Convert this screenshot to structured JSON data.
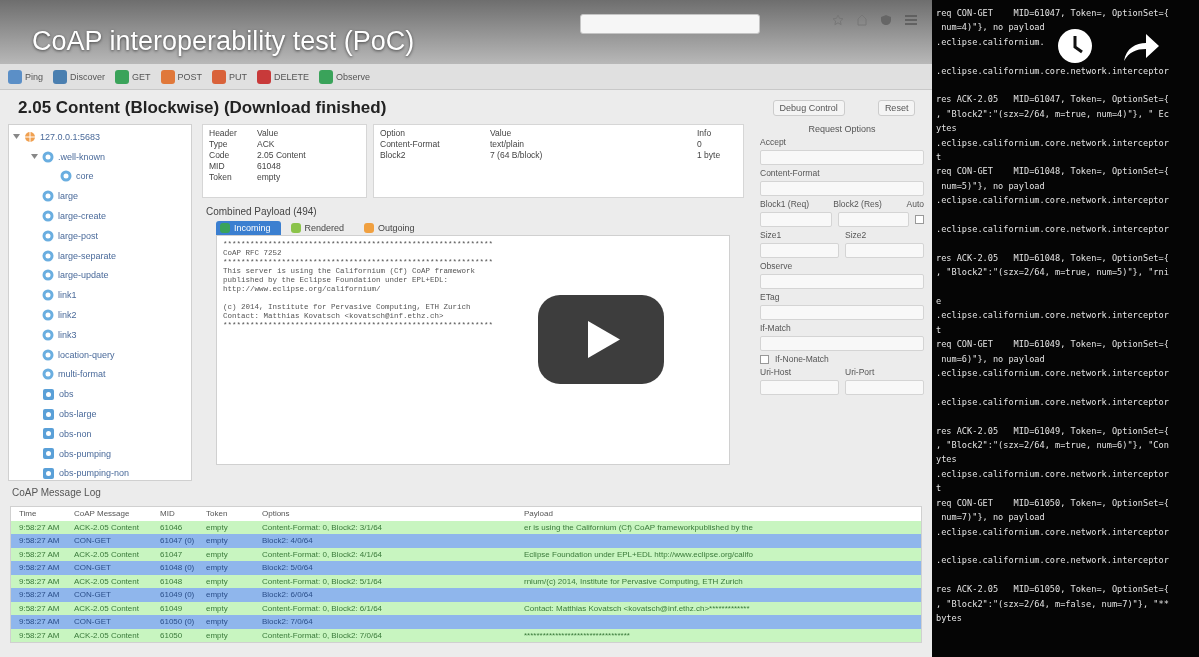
{
  "video": {
    "title": "CoAP interoperability test (PoC)"
  },
  "toolbar": {
    "buttons": [
      {
        "label": "Ping",
        "color": "#5b8fc7"
      },
      {
        "label": "Discover",
        "color": "#4a7fb0"
      },
      {
        "label": "GET",
        "color": "#3aa35a"
      },
      {
        "label": "POST",
        "color": "#e0783a"
      },
      {
        "label": "PUT",
        "color": "#d9623a"
      },
      {
        "label": "DELETE",
        "color": "#c83a3a"
      },
      {
        "label": "Observe",
        "color": "#3aa35a"
      }
    ]
  },
  "heading": "2.05 Content (Blockwise) (Download finished)",
  "tree": [
    {
      "label": "127.0.0.1:5683",
      "kind": "host",
      "expanded": true,
      "children": [
        {
          "label": ".well-known",
          "kind": "resource",
          "expanded": true,
          "children": [
            {
              "label": "core",
              "kind": "resource"
            }
          ]
        },
        {
          "label": "large",
          "kind": "resource"
        },
        {
          "label": "large-create",
          "kind": "resource"
        },
        {
          "label": "large-post",
          "kind": "resource"
        },
        {
          "label": "large-separate",
          "kind": "resource"
        },
        {
          "label": "large-update",
          "kind": "resource"
        },
        {
          "label": "link1",
          "kind": "resource"
        },
        {
          "label": "link2",
          "kind": "resource"
        },
        {
          "label": "link3",
          "kind": "resource"
        },
        {
          "label": "location-query",
          "kind": "resource"
        },
        {
          "label": "multi-format",
          "kind": "resource"
        },
        {
          "label": "obs",
          "kind": "observable"
        },
        {
          "label": "obs-large",
          "kind": "observable"
        },
        {
          "label": "obs-non",
          "kind": "observable"
        },
        {
          "label": "obs-pumping",
          "kind": "observable"
        },
        {
          "label": "obs-pumping-non",
          "kind": "observable"
        }
      ]
    }
  ],
  "header_table": {
    "columns": [
      "Header",
      "Value"
    ],
    "rows": [
      [
        "Type",
        "ACK"
      ],
      [
        "Code",
        "2.05 Content"
      ],
      [
        "MID",
        "61048"
      ],
      [
        "Token",
        "empty"
      ]
    ]
  },
  "options_table": {
    "columns": [
      "Option",
      "Value",
      "Info"
    ],
    "rows": [
      [
        "Content-Format",
        "text/plain",
        "0"
      ],
      [
        "Block2",
        "7 (64 B/block)",
        "1 byte"
      ]
    ]
  },
  "payload": {
    "title": "Combined Payload (494)",
    "tabs": [
      {
        "label": "Incoming",
        "selected": true
      },
      {
        "label": "Rendered",
        "selected": false
      },
      {
        "label": "Outgoing",
        "selected": false
      }
    ],
    "blocks": [
      [
        "************************************************************",
        "CoAP RFC 7252",
        "************************************************************",
        "This server is using the Californium (Cf) CoAP framework",
        "published by the Eclipse Foundation under EPL+EDL:",
        "http://www.eclipse.org/californium/"
      ],
      [
        "(c) 2014, Institute for Pervasive Computing, ETH Zurich",
        "Contact: Matthias Kovatsch <kovatsch@inf.ethz.ch>",
        "************************************************************"
      ]
    ]
  },
  "control_panel": {
    "buttons": [
      "Debug Control",
      "Reset"
    ],
    "items": [
      {
        "kind": "title",
        "label": "Request Options"
      },
      {
        "kind": "field",
        "labels": [
          "Accept"
        ]
      },
      {
        "kind": "field",
        "labels": [
          "Content-Format"
        ]
      },
      {
        "kind": "pair",
        "labels": [
          "Block1 (Req)",
          "Block2 (Res)",
          "Auto"
        ],
        "checked": false
      },
      {
        "kind": "pair",
        "labels": [
          "Size1",
          "Size2"
        ]
      },
      {
        "kind": "field",
        "labels": [
          "Observe"
        ]
      },
      {
        "kind": "field",
        "labels": [
          "ETag"
        ]
      },
      {
        "kind": "field",
        "labels": [
          "If-Match"
        ]
      },
      {
        "kind": "check",
        "labels": [
          "If-None-Match"
        ],
        "checked": false
      },
      {
        "kind": "pair",
        "labels": [
          "Uri-Host",
          "Uri-Port"
        ]
      }
    ]
  },
  "log": {
    "title": "CoAP Message Log",
    "columns": [
      "Time",
      "CoAP Message",
      "MID",
      "Token",
      "Options",
      "Payload"
    ],
    "rows": [
      {
        "kind": "ack",
        "cells": [
          "9:58:27 AM",
          "ACK-2.05 Content",
          "61046",
          "empty",
          "Content-Format: 0, Block2: 3/1/64",
          "er is using the Californium (Cf) CoAP frameworkpublished by the"
        ]
      },
      {
        "kind": "con",
        "cells": [
          "9:58:27 AM",
          "CON-GET",
          "61047 (0)",
          "empty",
          "Block2: 4/0/64"
        ]
      },
      {
        "kind": "ack",
        "cells": [
          "9:58:27 AM",
          "ACK-2.05 Content",
          "61047",
          "empty",
          "Content-Format: 0, Block2: 4/1/64",
          " Eclipse Foundation under EPL+EDL http://www.eclipse.org/califo"
        ]
      },
      {
        "kind": "con",
        "cells": [
          "9:58:27 AM",
          "CON-GET",
          "61048 (0)",
          "empty",
          "Block2: 5/0/64"
        ]
      },
      {
        "kind": "ack",
        "cells": [
          "9:58:27 AM",
          "ACK-2.05 Content",
          "61048",
          "empty",
          "Content-Format: 0, Block2: 5/1/64",
          "rnium/(c) 2014, Institute for Pervasive Computing, ETH Zurich"
        ]
      },
      {
        "kind": "con",
        "cells": [
          "9:58:27 AM",
          "CON-GET",
          "61049 (0)",
          "empty",
          "Block2: 6/0/64"
        ]
      },
      {
        "kind": "ack",
        "cells": [
          "9:58:27 AM",
          "ACK-2.05 Content",
          "61049",
          "empty",
          "Content-Format: 0, Block2: 6/1/64",
          "Contact: Matthias Kovatsch <kovatsch@inf.ethz.ch>*************"
        ]
      },
      {
        "kind": "con",
        "cells": [
          "9:58:27 AM",
          "CON-GET",
          "61050 (0)",
          "empty",
          "Block2: 7/0/64"
        ]
      },
      {
        "kind": "ack",
        "cells": [
          "9:58:27 AM",
          "ACK-2.05 Content",
          "61050",
          "empty",
          "Content-Format: 0, Block2: 7/0/64",
          "**********************************"
        ]
      }
    ]
  },
  "terminal": [
    [
      "req CON-GET    MID=61047, Token=, OptionSet={",
      " num=4)\"}, no payload",
      ".eclipse.californium."
    ],
    [
      ".eclipse.californium.core.network.interceptor"
    ],
    [
      "res ACK-2.05   MID=61047, Token=, OptionSet={",
      ", \"Block2\":\"(szx=2/64, m=true, num=4)\"}, \" Ec",
      "ytes",
      ".eclipse.californium.core.network.interceptor",
      "t",
      "req CON-GET    MID=61048, Token=, OptionSet={",
      " num=5)\"}, no payload",
      ".eclipse.californium.core.network.interceptor"
    ],
    [
      ".eclipse.californium.core.network.interceptor"
    ],
    [
      "res ACK-2.05   MID=61048, Token=, OptionSet={",
      ", \"Block2\":\"(szx=2/64, m=true, num=5)\"}, \"rni"
    ],
    [
      "e",
      ".eclipse.californium.core.network.interceptor",
      "t",
      "req CON-GET    MID=61049, Token=, OptionSet={",
      " num=6)\"}, no payload",
      ".eclipse.californium.core.network.interceptor"
    ],
    [
      ".eclipse.californium.core.network.interceptor"
    ],
    [
      "res ACK-2.05   MID=61049, Token=, OptionSet={",
      ", \"Block2\":\"(szx=2/64, m=true, num=6)\"}, \"Con",
      "ytes",
      ".eclipse.californium.core.network.interceptor",
      "t",
      "req CON-GET    MID=61050, Token=, OptionSet={",
      " num=7)\"}, no payload",
      ".eclipse.californium.core.network.interceptor"
    ],
    [
      ".eclipse.californium.core.network.interceptor"
    ],
    [
      "res ACK-2.05   MID=61050, Token=, OptionSet={",
      ", \"Block2\":\"(szx=2/64, m=false, num=7)\"}, \"**",
      "bytes"
    ]
  ]
}
